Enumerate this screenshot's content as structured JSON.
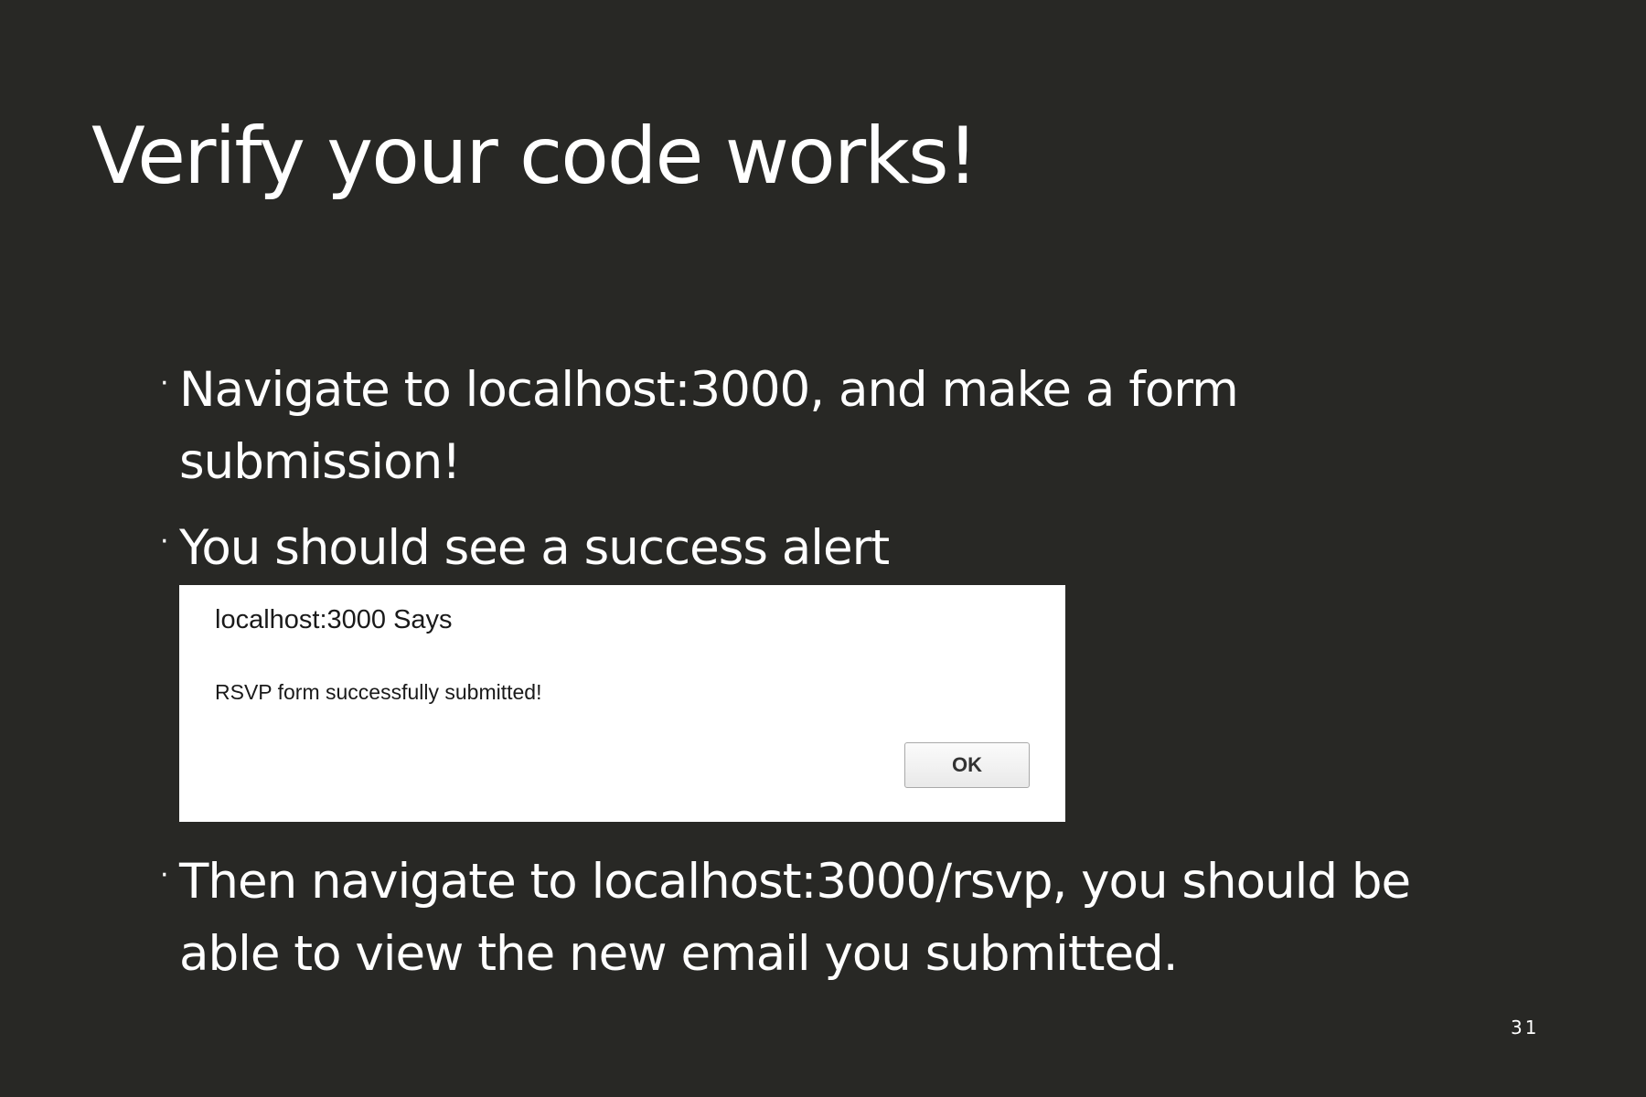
{
  "slide": {
    "title": "Verify your code works!",
    "bullet_marker": "·",
    "bullets": [
      {
        "line1": "Navigate to localhost:3000, and make a form",
        "line2": "submission!"
      },
      {
        "line1": "You should see a success alert"
      },
      {
        "line1": "Then navigate to localhost:3000/rsvp, you should be",
        "line2": "able to view the new email you submitted."
      }
    ],
    "page_number": "31"
  },
  "alert": {
    "title": "localhost:3000 Says",
    "message": "RSVP form successfully submitted!",
    "ok_label": "OK"
  }
}
